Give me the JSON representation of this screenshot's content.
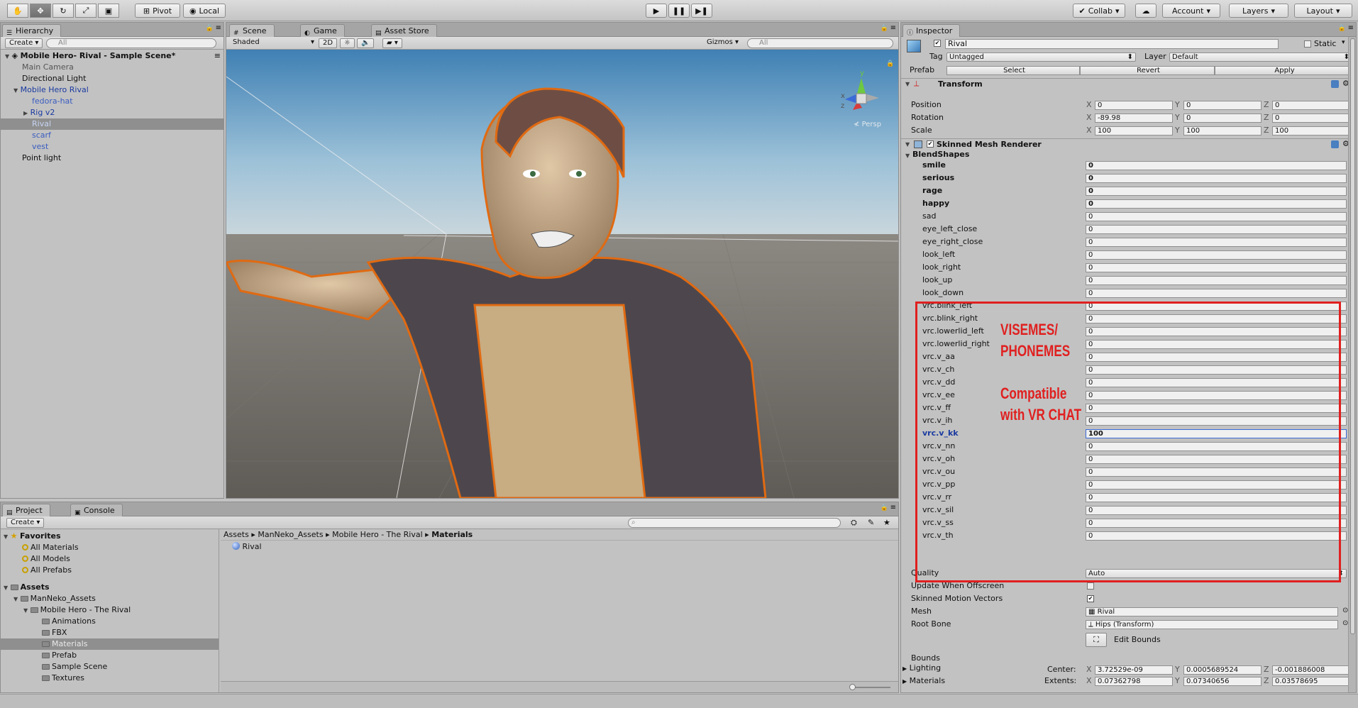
{
  "toolbar": {
    "pivot": "Pivot",
    "local": "Local",
    "collab": "Collab",
    "account": "Account",
    "layers": "Layers",
    "layout": "Layout"
  },
  "hierarchy": {
    "tab": "Hierarchy",
    "create": "Create",
    "search_placeholder": "All",
    "scene": "Mobile Hero- Rival - Sample Scene*",
    "items": [
      {
        "label": "Main Camera"
      },
      {
        "label": "Directional Light"
      },
      {
        "label": "Mobile Hero Rival"
      },
      {
        "label": "fedora-hat"
      },
      {
        "label": "Rig v2"
      },
      {
        "label": "Rival"
      },
      {
        "label": "scarf"
      },
      {
        "label": "vest"
      },
      {
        "label": "Point light"
      }
    ]
  },
  "scene_view": {
    "tabs": [
      "Scene",
      "Game",
      "Asset Store"
    ],
    "shading": "Shaded",
    "mode_2d": "2D",
    "gizmos": "Gizmos",
    "search_placeholder": "All",
    "persp": "Persp",
    "axis_y": "y",
    "axis_x": "x",
    "axis_z": "z"
  },
  "project": {
    "tabs": [
      "Project",
      "Console"
    ],
    "create": "Create",
    "favorites": "Favorites",
    "favorite_items": [
      "All Materials",
      "All Models",
      "All Prefabs"
    ],
    "assets": "Assets",
    "tree": [
      "ManNeko_Assets",
      "Mobile Hero - The Rival",
      "Animations",
      "FBX",
      "Materials",
      "Prefab",
      "Sample Scene",
      "Textures"
    ],
    "breadcrumb": [
      "Assets",
      "ManNeko_Assets",
      "Mobile Hero - The Rival",
      "Materials"
    ],
    "files": [
      "Rival"
    ]
  },
  "inspector": {
    "tab": "Inspector",
    "object_name": "Rival",
    "static": "Static",
    "tag_label": "Tag",
    "tag_value": "Untagged",
    "layer_label": "Layer",
    "layer_value": "Default",
    "prefab_label": "Prefab",
    "prefab_select": "Select",
    "prefab_revert": "Revert",
    "prefab_apply": "Apply",
    "transform": {
      "title": "Transform",
      "position_label": "Position",
      "rotation_label": "Rotation",
      "scale_label": "Scale",
      "x": "X",
      "y": "Y",
      "z": "Z",
      "position": [
        "0",
        "0",
        "0"
      ],
      "rotation": [
        "-89.98",
        "0",
        "0"
      ],
      "scale": [
        "100",
        "100",
        "100"
      ]
    },
    "renderer_title": "Skinned Mesh Renderer",
    "blendshapes_title": "BlendShapes",
    "blendshapes": [
      {
        "name": "smile",
        "value": "0"
      },
      {
        "name": "serious",
        "value": "0"
      },
      {
        "name": "rage",
        "value": "0"
      },
      {
        "name": "happy",
        "value": "0"
      },
      {
        "name": "sad",
        "value": "0"
      },
      {
        "name": "eye_left_close",
        "value": "0"
      },
      {
        "name": "eye_right_close",
        "value": "0"
      },
      {
        "name": "look_left",
        "value": "0"
      },
      {
        "name": "look_right",
        "value": "0"
      },
      {
        "name": "look_up",
        "value": "0"
      },
      {
        "name": "look_down",
        "value": "0"
      },
      {
        "name": "vrc.blink_left",
        "value": "0"
      },
      {
        "name": "vrc.blink_right",
        "value": "0"
      },
      {
        "name": "vrc.lowerlid_left",
        "value": "0"
      },
      {
        "name": "vrc.lowerlid_right",
        "value": "0"
      },
      {
        "name": "vrc.v_aa",
        "value": "0"
      },
      {
        "name": "vrc.v_ch",
        "value": "0"
      },
      {
        "name": "vrc.v_dd",
        "value": "0"
      },
      {
        "name": "vrc.v_ee",
        "value": "0"
      },
      {
        "name": "vrc.v_ff",
        "value": "0"
      },
      {
        "name": "vrc.v_ih",
        "value": "0"
      },
      {
        "name": "vrc.v_kk",
        "value": "100"
      },
      {
        "name": "vrc.v_nn",
        "value": "0"
      },
      {
        "name": "vrc.v_oh",
        "value": "0"
      },
      {
        "name": "vrc.v_ou",
        "value": "0"
      },
      {
        "name": "vrc.v_pp",
        "value": "0"
      },
      {
        "name": "vrc.v_rr",
        "value": "0"
      },
      {
        "name": "vrc.v_sil",
        "value": "0"
      },
      {
        "name": "vrc.v_ss",
        "value": "0"
      },
      {
        "name": "vrc.v_th",
        "value": "0"
      }
    ],
    "quality_label": "Quality",
    "quality_value": "Auto",
    "update_offscreen_label": "Update When Offscreen",
    "update_offscreen": false,
    "skinned_motion_label": "Skinned Motion Vectors",
    "skinned_motion": true,
    "mesh_label": "Mesh",
    "mesh_value": "Rival",
    "root_bone_label": "Root Bone",
    "root_bone_value": "Hips (Transform)",
    "edit_bounds": "Edit Bounds",
    "bounds_label": "Bounds",
    "center_label": "Center:",
    "extents_label": "Extents:",
    "center": [
      "3.72529e-09",
      "0.0005689524",
      "-0.001886008"
    ],
    "extents": [
      "0.07362798",
      "0.07340656",
      "0.03578695"
    ],
    "lighting": "Lighting",
    "materials": "Materials"
  },
  "annotation": {
    "line1": "VISEMES/",
    "line2": "PHONEMES",
    "line3": "Compatible",
    "line4": "with VR CHAT",
    "color": "#e02020"
  }
}
